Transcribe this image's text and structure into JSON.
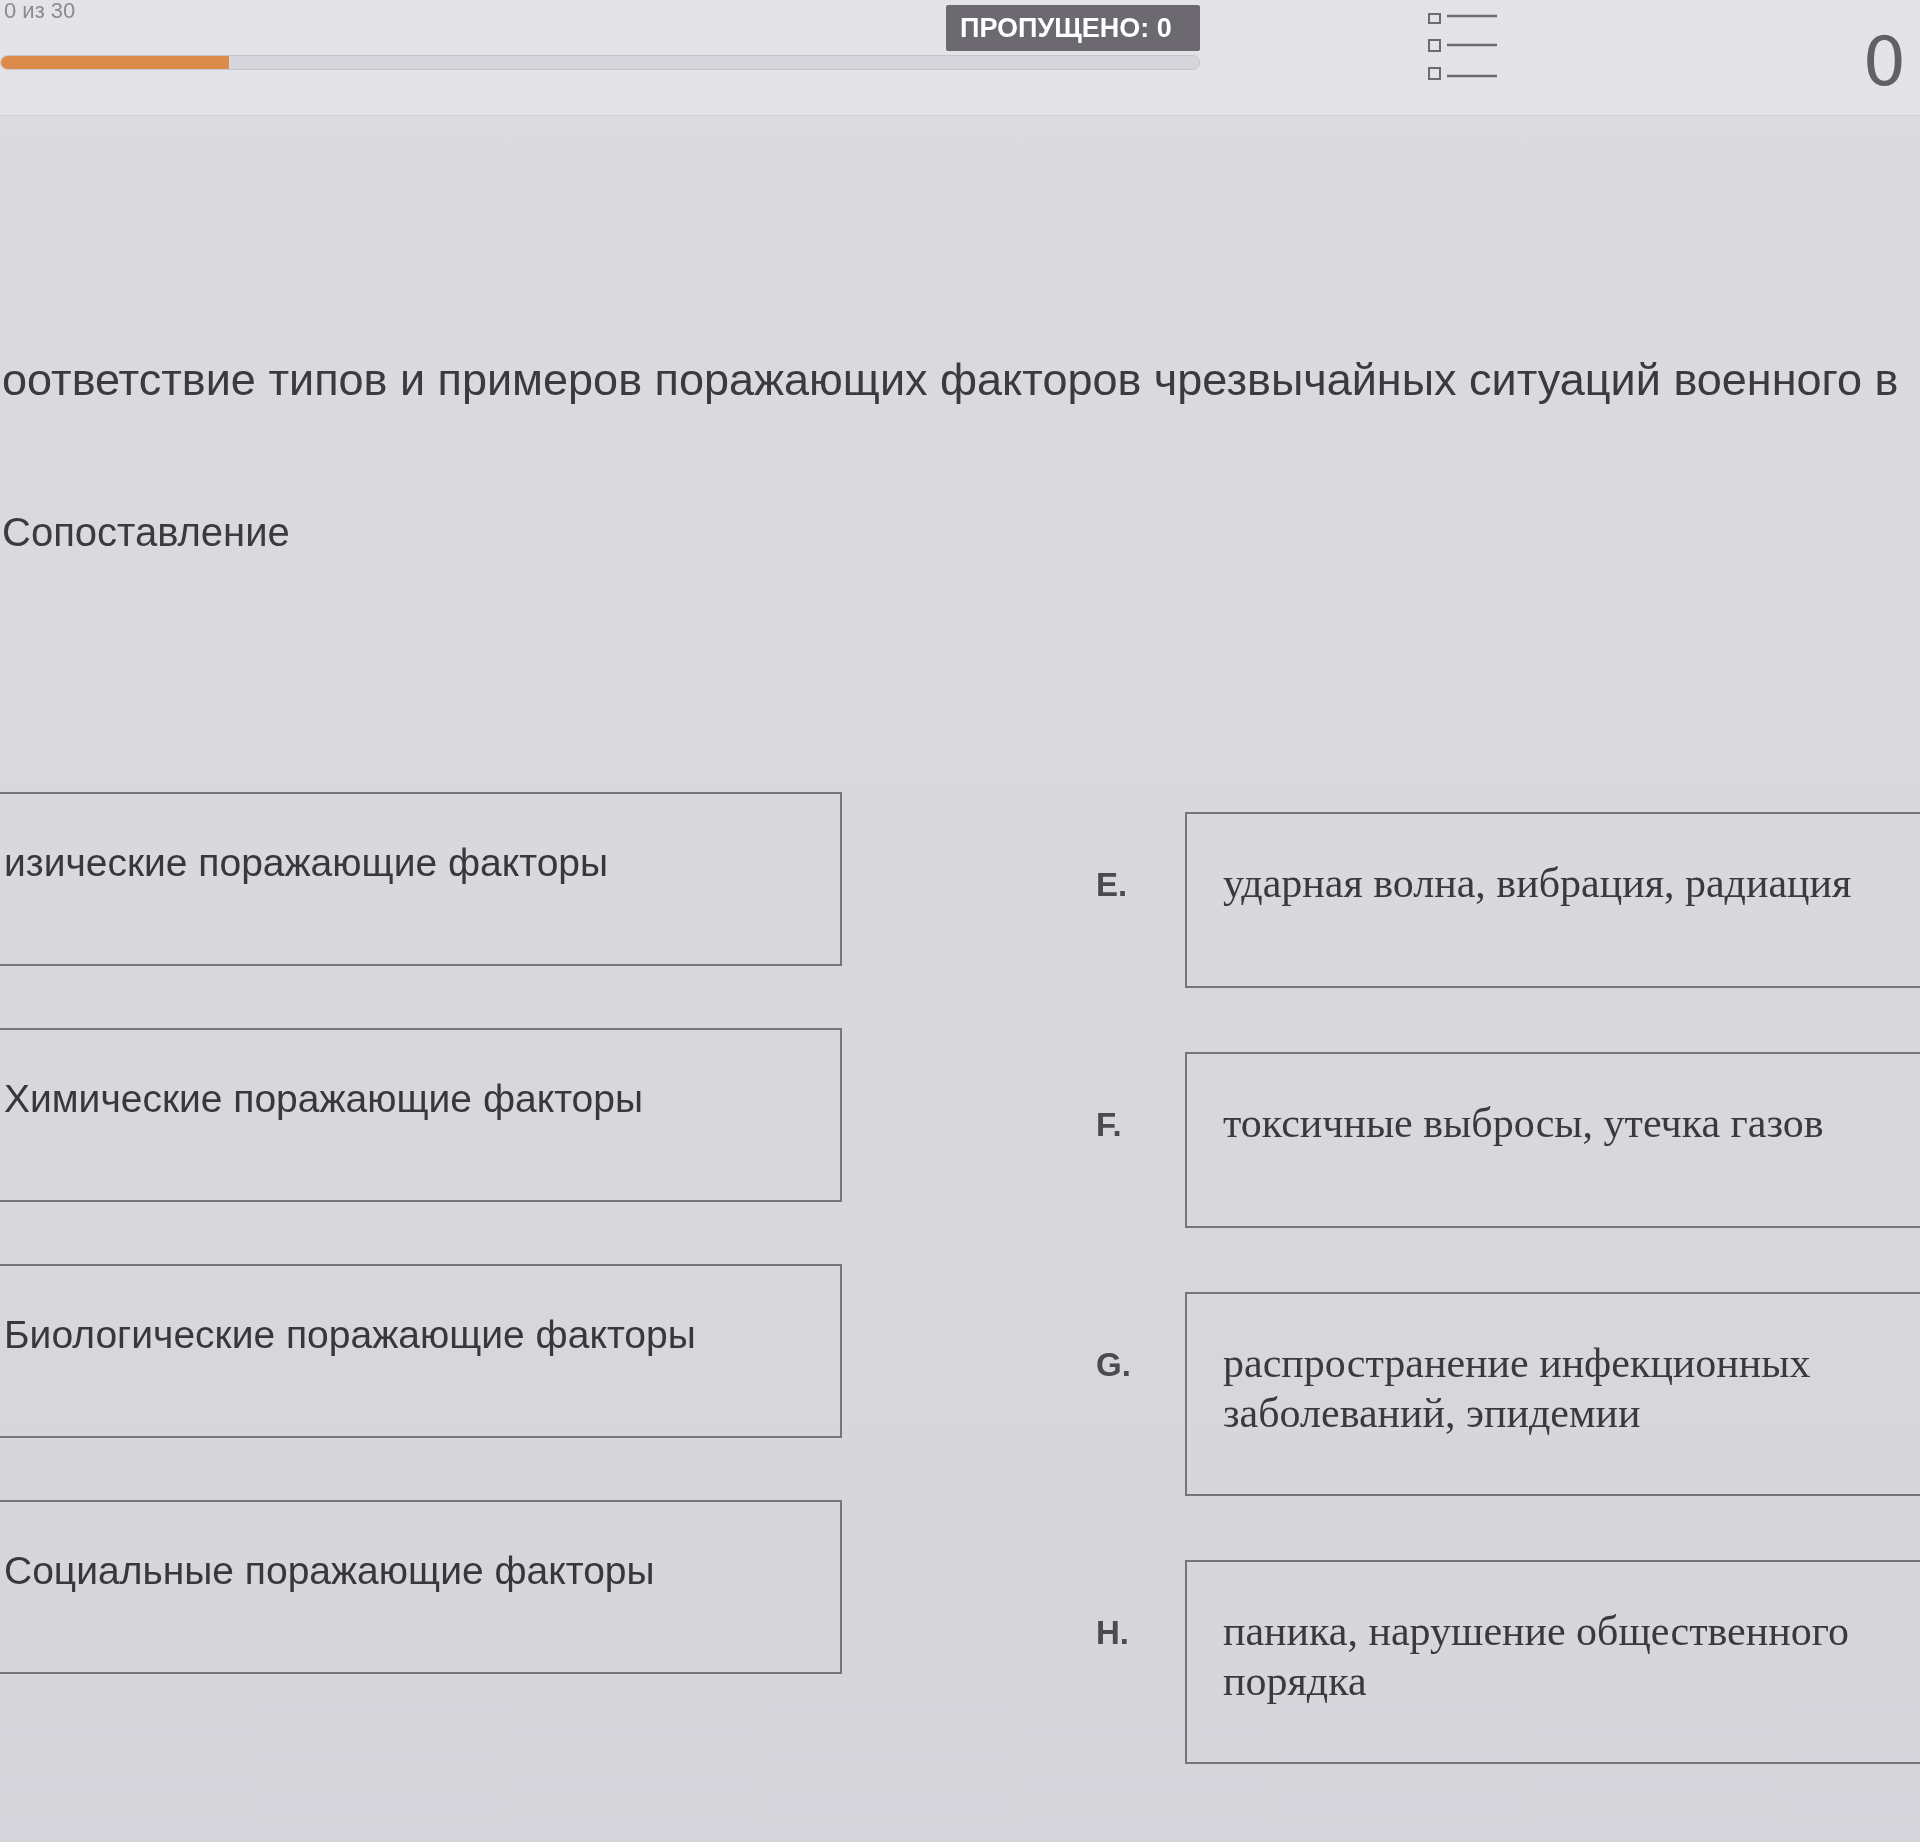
{
  "header": {
    "counter": "0 из 30",
    "skipped_badge": "ПРОПУЩЕНО: 0",
    "progress": {
      "level": 0.19
    },
    "score": "0"
  },
  "question": {
    "text": "оответствие типов и примеров поражающих факторов чрезвычайных ситуаций военного в",
    "type_label": "Сопоставление"
  },
  "matching": {
    "left_items": [
      "изические поражающие факторы",
      "Химические поражающие факторы",
      "Биологические поражающие факторы",
      "Социальные поражающие факторы"
    ],
    "right_items": [
      {
        "letter": "E.",
        "text": "ударная волна, вибрация, радиация"
      },
      {
        "letter": "F.",
        "text": "токсичные выбросы, утечка газов"
      },
      {
        "letter": "G.",
        "text": "распространение инфекционных заболеваний, эпидемии"
      },
      {
        "letter": "H.",
        "text": "паника, нарушение общественного порядка"
      }
    ]
  }
}
